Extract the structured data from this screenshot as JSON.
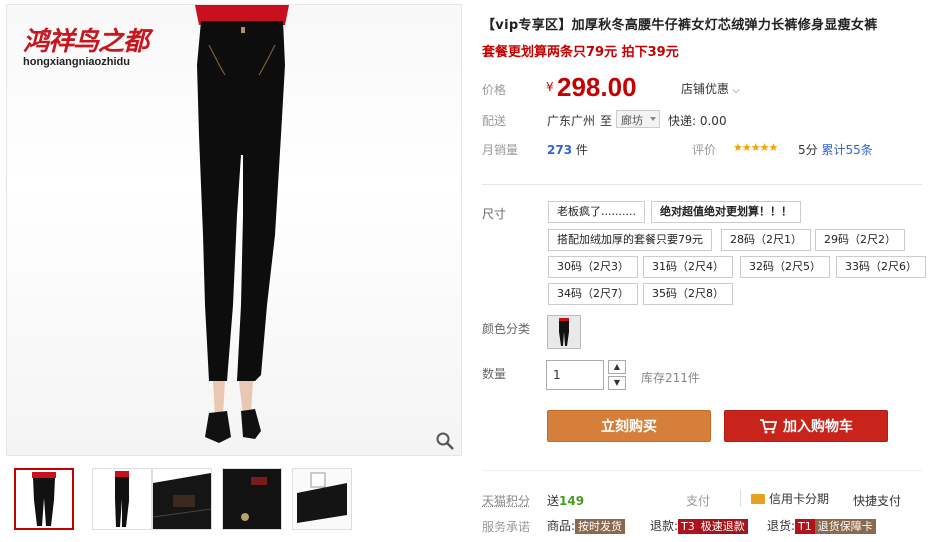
{
  "logo": {
    "main": "鸿祥鸟之都",
    "sub": "hongxiangniaozhidu"
  },
  "title": "【vip专享区】加厚秋冬高腰牛仔裤女灯芯绒弹力长裤修身显瘦女裤",
  "promo": "套餐更划算两条只79元 拍下39元",
  "price": {
    "label": "价格",
    "currency": "¥",
    "value": "298.00",
    "shop_promo": "店铺优惠"
  },
  "shipping": {
    "label": "配送",
    "from": "广东广州",
    "to_label": "至",
    "destination": "廊坊",
    "fee": "快递: 0.00"
  },
  "sales": {
    "label": "月销量",
    "count": "273",
    "unit": "件",
    "rating_label": "评价",
    "stars": "★★★★★",
    "score": "5分",
    "reviews": "累计55条"
  },
  "size": {
    "label": "尺寸",
    "options": [
      "老板疯了..........",
      "绝对超值绝对更划算！！！",
      "搭配加绒加厚的套餐只要79元",
      "28码（2尺1）",
      "29码（2尺2）",
      "30码（2尺3）",
      "31码（2尺4）",
      "32码（2尺5）",
      "33码（2尺6）",
      "34码（2尺7）",
      "35码（2尺8）"
    ]
  },
  "color": {
    "label": "颜色分类"
  },
  "quantity": {
    "label": "数量",
    "value": "1",
    "stock": "库存211件"
  },
  "buttons": {
    "buy": "立刻购买",
    "cart": "加入购物车"
  },
  "footer": {
    "points_label": "天猫积分",
    "points_prefix": "送",
    "points": "149",
    "pay_label": "支付",
    "credit": "信用卡分期",
    "quick": "快捷支付",
    "service_label": "服务承诺",
    "goods_label": "商品:",
    "goods_badge": "按时发货",
    "refund_label": "退款:",
    "refund_t": "T3",
    "refund_badge": "极速退款",
    "return_label": "退货:",
    "return_t": "T1",
    "return_badge": "退货保障卡"
  },
  "colors": {
    "price_red": "#c40000",
    "buy": "#d57f3b",
    "cart": "#c9241b",
    "link": "#3366cc"
  }
}
